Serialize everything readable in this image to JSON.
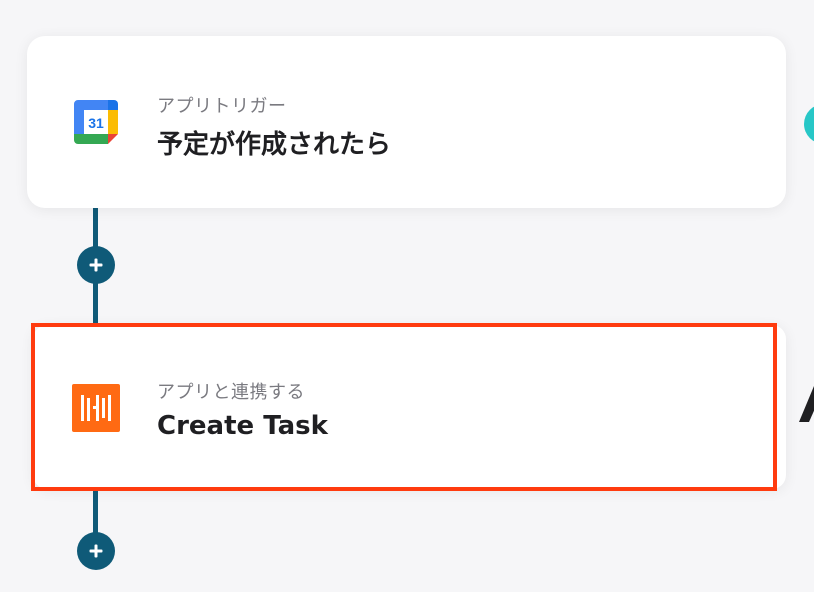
{
  "trigger_card": {
    "subtitle": "アプリトリガー",
    "title": "予定が作成されたら",
    "icon": "google-calendar-icon",
    "icon_number": "31"
  },
  "action_card": {
    "subtitle": "アプリと連携する",
    "title": "Create Task",
    "icon": "hive-app-icon",
    "highlighted": true
  },
  "colors": {
    "connector": "#0f5a78",
    "highlight": "#ff3b0f",
    "action_icon_bg": "#ff6a13",
    "side_dot": "#27c7c7",
    "background": "#f6f6f8"
  }
}
